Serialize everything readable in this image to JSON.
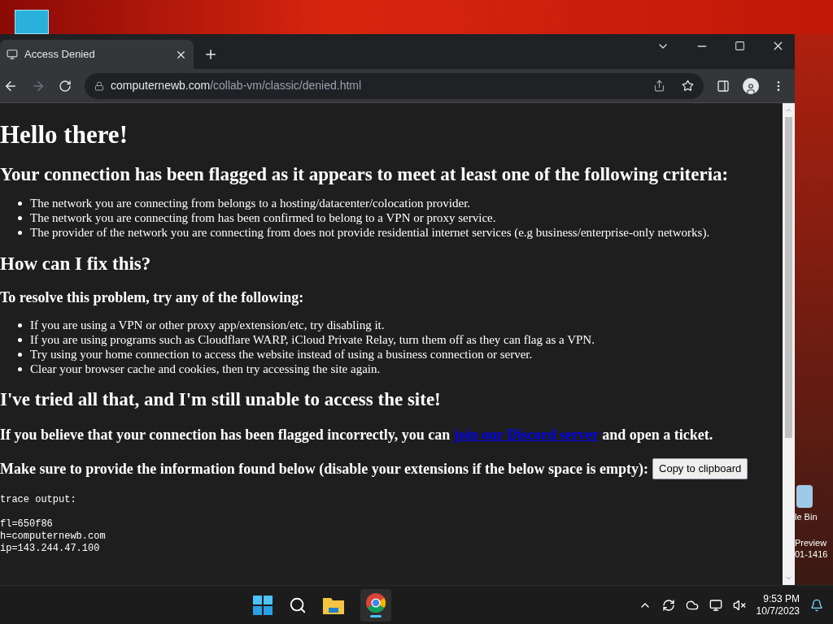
{
  "browser": {
    "tab": {
      "title": "Access Denied",
      "selected": true
    },
    "url": {
      "domain": "computernewb.com",
      "path": "/collab-vm/classic/denied.html"
    }
  },
  "page": {
    "title": "Hello there!",
    "criteria_heading": "Your connection has been flagged as it appears to meet at least one of the following criteria:",
    "criteria": [
      "The network you are connecting from belongs to a hosting/datacenter/colocation provider.",
      "The network you are connecting from has been confirmed to belong to a VPN or proxy service.",
      "The provider of the network you are connecting from does not provide residential internet services (e.g business/enterprise-only networks)."
    ],
    "fix_heading": "How can I fix this?",
    "resolve_heading": "To resolve this problem, try any of the following:",
    "steps": [
      "If you are using a VPN or other proxy app/extension/etc, try disabling it.",
      "If you are using programs such as Cloudflare WARP, iCloud Private Relay, turn them off as they can flag as a VPN.",
      "Try using your home connection to access the website instead of using a business connection or server.",
      "Clear your browser cache and cookies, then try accessing the site again."
    ],
    "tried_heading": "I've tried all that, and I'm still unable to access the site!",
    "flagged": {
      "before": "If you believe that your connection has been flagged incorrectly, you can",
      "link": "join our Discord server",
      "after": "and open a ticket."
    },
    "provide": "Make sure to provide the information found below (disable your extensions if the below space is empty):",
    "copy_button": "Copy to clipboard",
    "trace": {
      "label": "trace output:",
      "lines": [
        "fl=650f86",
        "h=computernewb.com",
        "ip=143.244.47.100"
      ]
    }
  },
  "desktop_icons": [
    "le Bin",
    "Preview",
    "01-1416"
  ],
  "taskbar": {
    "time": "9:53 PM",
    "date": "10/7/2023"
  }
}
